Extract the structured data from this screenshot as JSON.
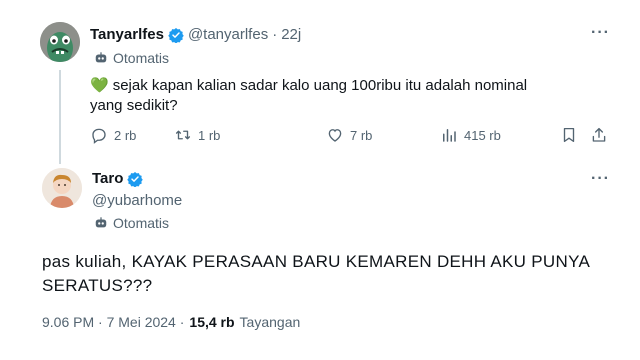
{
  "tweet1": {
    "name": "Tanyarlfes",
    "handle": "@tanyarlfes",
    "separator": "·",
    "time": "22j",
    "auto_label": "Otomatis",
    "text": "sejak kapan kalian sadar kalo uang 100ribu itu adalah nominal yang sedikit?",
    "heart_emoji": "💚",
    "more": "···",
    "replies": "2 rb",
    "retweets": "1 rb",
    "likes": "7 rb",
    "views": "415 rb"
  },
  "tweet2": {
    "name": "Taro",
    "handle": "@yubarhome",
    "auto_label": "Otomatis",
    "more": "···",
    "text": "pas kuliah, KAYAK PERASAAN BARU KEMAREN DEHH AKU PUNYA SERATUS???",
    "timestamp": "9.06 PM · 7 Mei 2024 ·",
    "views_count": "15,4 rb",
    "views_label": "Tayangan"
  },
  "colors": {
    "verified": "#1d9bf0",
    "muted": "#536471",
    "text": "#0f1419",
    "thread_line": "#cfd9de"
  },
  "icons": [
    "verified-badge-icon",
    "robot-icon",
    "reply-icon",
    "retweet-icon",
    "like-icon",
    "views-icon",
    "bookmark-icon",
    "share-icon",
    "more-icon"
  ]
}
